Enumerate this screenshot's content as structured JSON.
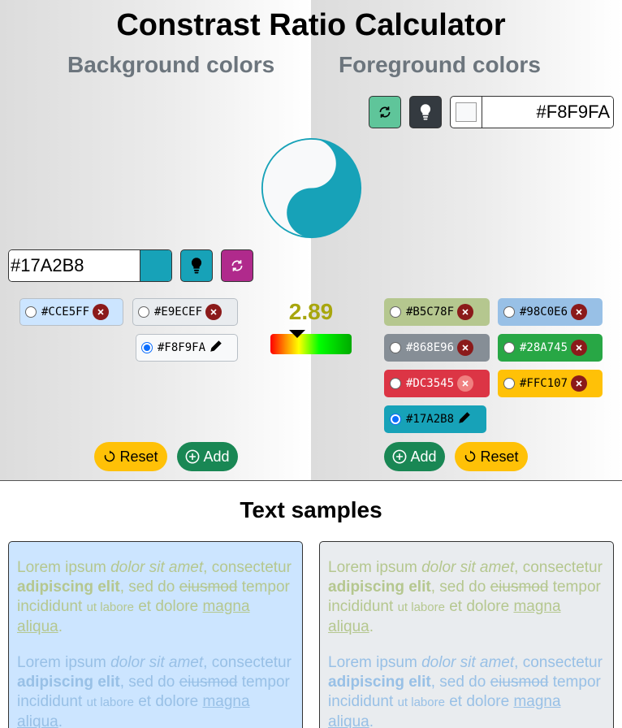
{
  "app_title": "Constrast Ratio Calculator",
  "background": {
    "title": "Background colors",
    "hex_value": "#17A2B8",
    "swatch_color": "#17A2B8",
    "chips": [
      {
        "label": "#CCE5FF",
        "color": "#CCE5FF",
        "selected": false,
        "action": "remove"
      },
      {
        "label": "#E9ECEF",
        "color": "#E9ECEF",
        "selected": false,
        "action": "remove"
      },
      {
        "label": "#F8F9FA",
        "color": "#F8F9FA",
        "selected": true,
        "action": "edit"
      }
    ],
    "reset_label": "Reset",
    "add_label": "Add"
  },
  "foreground": {
    "title": "Foreground colors",
    "hex_value": "#F8F9FA",
    "swatch_color": "#F8F9FA",
    "chips": [
      {
        "label": "#B5C78F",
        "color": "#B5C78F",
        "selected": false,
        "action": "remove"
      },
      {
        "label": "#98C0E6",
        "color": "#98C0E6",
        "selected": false,
        "action": "remove"
      },
      {
        "label": "#868E96",
        "color": "#868E96",
        "selected": false,
        "action": "remove"
      },
      {
        "label": "#28A745",
        "color": "#28A745",
        "selected": false,
        "action": "remove"
      },
      {
        "label": "#DC3545",
        "color": "#DC3545",
        "selected": false,
        "action": "remove"
      },
      {
        "label": "#FFC107",
        "color": "#FFC107",
        "selected": false,
        "action": "remove"
      },
      {
        "label": "#17A2B8",
        "color": "#17A2B8",
        "selected": true,
        "action": "edit"
      }
    ],
    "add_label": "Add",
    "reset_label": "Reset"
  },
  "contrast": {
    "ratio": "2.89",
    "level": 0.33
  },
  "icons": {
    "swap": "swap-icon",
    "bulb": "lightbulb-icon",
    "remove": "close-icon",
    "edit": "pencil-icon",
    "reset": "reset-icon",
    "add": "plus-circle-icon"
  },
  "colors": {
    "swap_bg": "#5fc59a",
    "bulb_bg_fg": "#343a40",
    "bulb_bg_bg": "#17A2B8",
    "swap_bg_bg": "#b02a8c",
    "reset_bg": "#ffc107",
    "add_bg": "#198754"
  },
  "samples": {
    "title": "Text samples",
    "paragraph": {
      "p1": "Lorem ipsum ",
      "em": "dolor sit amet",
      "p2": ", consectetur ",
      "b": "adipiscing elit",
      "p3": ", sed do ",
      "s": "eiusmod",
      "p4": " tempor incididunt ",
      "small": "ut labore",
      "p5": " et dolore ",
      "u": "magna aliqua",
      "p6": "."
    },
    "cards": [
      {
        "bg": "#CCE5FF",
        "colors": [
          "#B5C78F",
          "#98C0E6"
        ]
      },
      {
        "bg": "#E9ECEF",
        "colors": [
          "#B5C78F",
          "#98C0E6"
        ]
      }
    ]
  }
}
